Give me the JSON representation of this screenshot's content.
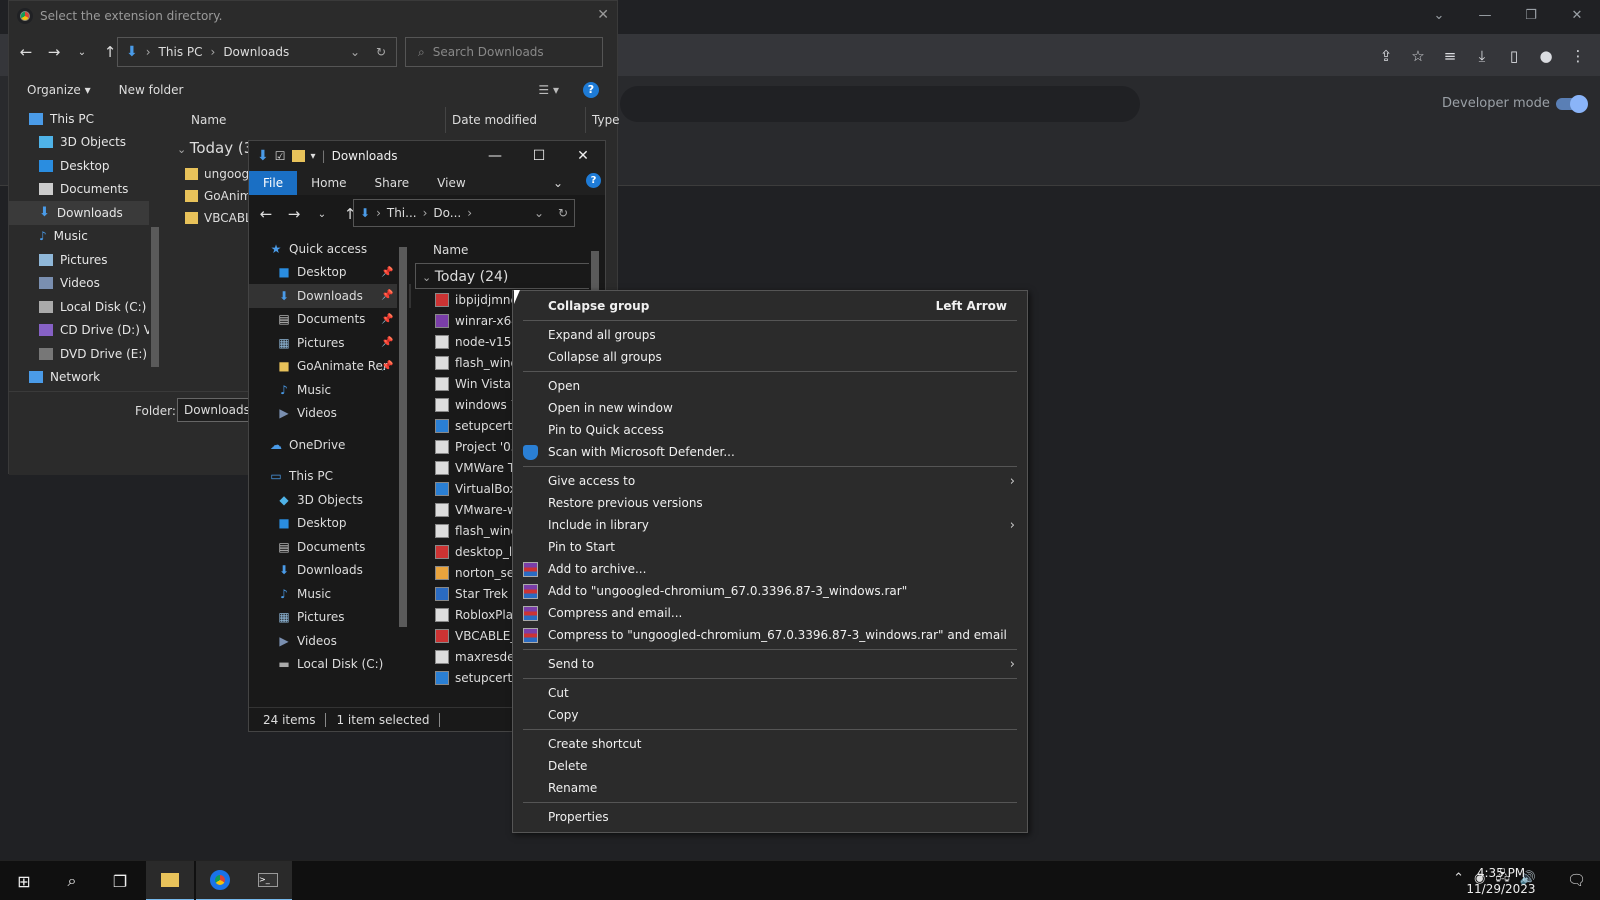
{
  "chrome": {
    "developer_mode_label": "Developer mode",
    "window_controls": [
      "chevron-down",
      "minimize",
      "restore",
      "close"
    ],
    "toolbar_icons": [
      "share-icon",
      "star-icon",
      "reading-list-icon",
      "download-icon",
      "side-panel-icon",
      "profile-icon",
      "menu-icon"
    ]
  },
  "dialog": {
    "title": "Select the extension directory.",
    "address": {
      "root": "This PC",
      "current": "Downloads"
    },
    "search_placeholder": "Search Downloads",
    "organize_label": "Organize",
    "new_folder_label": "New folder",
    "columns": {
      "name": "Name",
      "date_modified": "Date modified",
      "type": "Type"
    },
    "tree": [
      "This PC",
      "3D Objects",
      "Desktop",
      "Documents",
      "Downloads",
      "Music",
      "Pictures",
      "Videos",
      "Local Disk (C:)",
      "CD Drive (D:) VS",
      "DVD Drive (E:) VI",
      "Network"
    ],
    "group": "Today (3",
    "files": [
      "ungoog",
      "GoAnim",
      "VBCABL"
    ],
    "folder_label": "Folder:",
    "folder_value": "Downloads"
  },
  "explorer": {
    "title": "Downloads",
    "ribbon": {
      "file": "File",
      "home": "Home",
      "share": "Share",
      "view": "View"
    },
    "address": {
      "a": "Thi...",
      "b": "Do..."
    },
    "column_name": "Name",
    "group": "Today (24)",
    "tree": [
      {
        "label": "Quick access",
        "level": 0
      },
      {
        "label": "Desktop",
        "level": 1,
        "pin": true
      },
      {
        "label": "Downloads",
        "level": 1,
        "pin": true,
        "sel": true
      },
      {
        "label": "Documents",
        "level": 1,
        "pin": true
      },
      {
        "label": "Pictures",
        "level": 1,
        "pin": true
      },
      {
        "label": "GoAnimate Rer",
        "level": 1,
        "pin": true
      },
      {
        "label": "Music",
        "level": 1
      },
      {
        "label": "Videos",
        "level": 1
      },
      {
        "label": "OneDrive",
        "level": 0
      },
      {
        "label": "This PC",
        "level": 0
      },
      {
        "label": "3D Objects",
        "level": 1
      },
      {
        "label": "Desktop",
        "level": 1
      },
      {
        "label": "Documents",
        "level": 1
      },
      {
        "label": "Downloads",
        "level": 1
      },
      {
        "label": "Music",
        "level": 1
      },
      {
        "label": "Pictures",
        "level": 1
      },
      {
        "label": "Videos",
        "level": 1
      },
      {
        "label": "Local Disk (C:)",
        "level": 1
      }
    ],
    "files": [
      "ibpijdjmnc",
      "winrar-x64",
      "node-v15.0",
      "flash_wind",
      "Win Vista U",
      "windows 7",
      "setupcert (",
      "Project '05",
      "VMWare To",
      "VirtualBox-",
      "VMware-w",
      "flash_wind",
      "desktop_lig",
      "norton_sec",
      "Star Trek Fl",
      "RobloxPlay",
      "VBCABLE_I",
      "maxresdef",
      "setupcert"
    ],
    "status_items": "24 items",
    "status_selected": "1 item selected"
  },
  "context_menu": {
    "items": [
      {
        "label": "Collapse group",
        "shortcut": "Left Arrow",
        "bold": true
      },
      {
        "sep": true
      },
      {
        "label": "Expand all groups"
      },
      {
        "label": "Collapse all groups"
      },
      {
        "sep": true
      },
      {
        "label": "Open"
      },
      {
        "label": "Open in new window"
      },
      {
        "label": "Pin to Quick access"
      },
      {
        "label": "Scan with Microsoft Defender...",
        "icon": "shield"
      },
      {
        "sep": true
      },
      {
        "label": "Give access to",
        "submenu": true
      },
      {
        "label": "Restore previous versions"
      },
      {
        "label": "Include in library",
        "submenu": true
      },
      {
        "label": "Pin to Start"
      },
      {
        "label": "Add to archive...",
        "icon": "rar"
      },
      {
        "label": "Add to \"ungoogled-chromium_67.0.3396.87-3_windows.rar\"",
        "icon": "rar"
      },
      {
        "label": "Compress and email...",
        "icon": "rar"
      },
      {
        "label": "Compress to \"ungoogled-chromium_67.0.3396.87-3_windows.rar\" and email",
        "icon": "rar"
      },
      {
        "sep": true
      },
      {
        "label": "Send to",
        "submenu": true
      },
      {
        "sep": true
      },
      {
        "label": "Cut"
      },
      {
        "label": "Copy"
      },
      {
        "sep": true
      },
      {
        "label": "Create shortcut"
      },
      {
        "label": "Delete"
      },
      {
        "label": "Rename"
      },
      {
        "sep": true
      },
      {
        "label": "Properties"
      }
    ]
  },
  "taskbar": {
    "time": "4:35 PM",
    "date": "11/29/2023"
  },
  "colors": {
    "accent": "#1a6fc4",
    "folder": "#e8c25a",
    "chrome_bg": "#202124"
  }
}
